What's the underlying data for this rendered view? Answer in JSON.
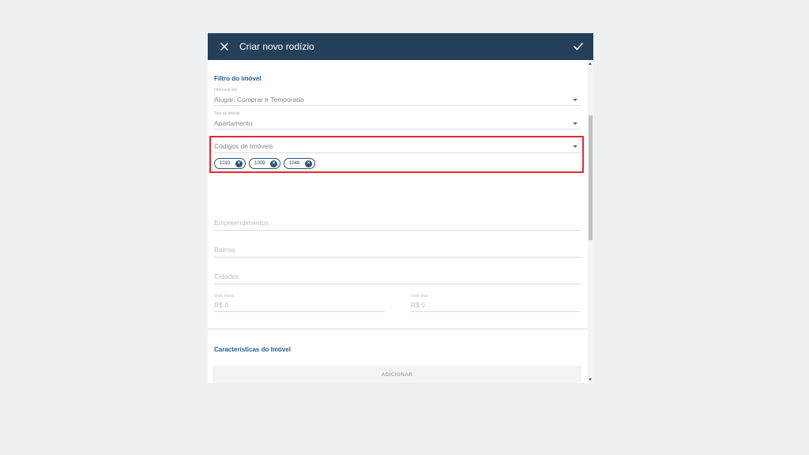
{
  "header": {
    "title": "Criar novo rodízio",
    "close_icon": "close-icon",
    "confirm_icon": "check-icon",
    "background": "#243f5a"
  },
  "filtro": {
    "section_title": "Filtro do imóvel",
    "interesse": {
      "label": "Interesse em",
      "value": "Alugar, Comprar e Temporada"
    },
    "tipo": {
      "label": "Tipo do Imóvel",
      "value": "Apartamento"
    },
    "codigos": {
      "label": "Códigos de Imóveis",
      "chips": [
        "1010",
        "1009",
        "1048"
      ]
    },
    "empreendimentos": {
      "placeholder": "Empreendimentos"
    },
    "bairros": {
      "placeholder": "Bairros"
    },
    "cidades": {
      "placeholder": "Cidades"
    },
    "valor_inicial": {
      "label": "Valor inicial",
      "value": "R$ 0"
    },
    "valor_final": {
      "label": "Valor final",
      "value": "R$ 0"
    }
  },
  "caracteristicas": {
    "section_title": "Características do Imóvel",
    "add_label": "ADICIONAR"
  },
  "colors": {
    "accent": "#24608f",
    "highlight": "#e52a2f",
    "page_bg": "#edf1f2"
  }
}
